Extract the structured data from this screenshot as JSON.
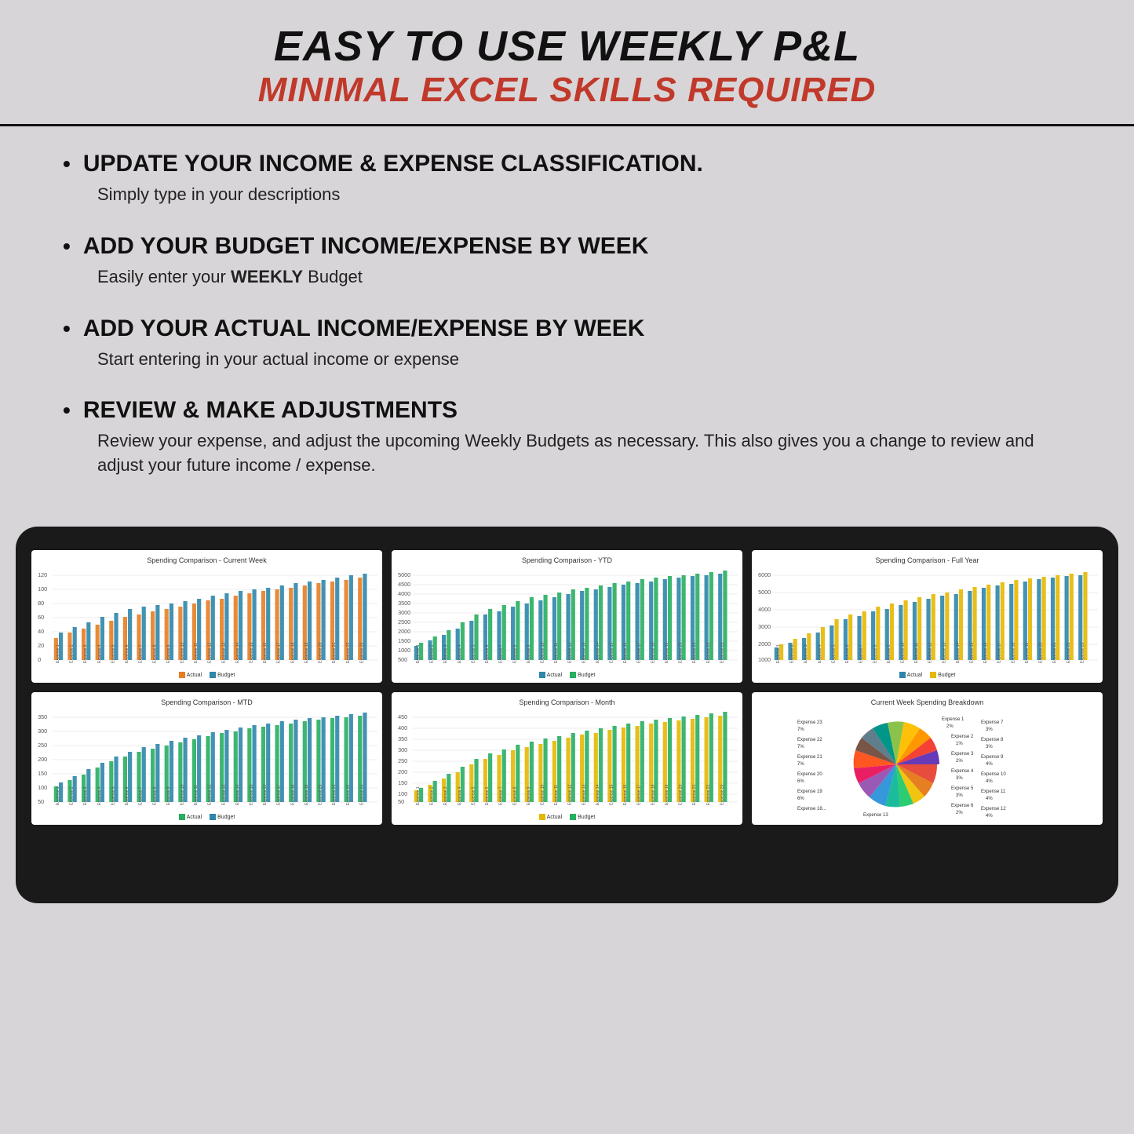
{
  "header": {
    "title_main": "EASY TO USE WEEKLY P&L",
    "title_sub": "MINIMAL EXCEL SKILLS REQUIRED"
  },
  "bullets": [
    {
      "id": "classification",
      "title": "UPDATE YOUR INCOME & EXPENSE CLASSIFICATION.",
      "body": "Simply type in your descriptions"
    },
    {
      "id": "budget",
      "title": "ADD YOUR BUDGET INCOME/EXPENSE BY WEEK",
      "body_prefix": "Easily enter your ",
      "body_bold": "WEEKLY",
      "body_suffix": " Budget"
    },
    {
      "id": "actual",
      "title": "ADD YOUR ACTUAL INCOME/EXPENSE BY WEEK",
      "body": "Start entering in your actual income or expense"
    },
    {
      "id": "review",
      "title": "REVIEW & MAKE ADJUSTMENTS",
      "body": "Review your expense, and adjust the upcoming Weekly Budgets as necessary.  This also gives you a change to review and adjust your future income / expense."
    }
  ],
  "charts": {
    "current_week": {
      "title": "Spending Comparison - Current Week",
      "y_max": 120,
      "legend": [
        "Actual",
        "Budget"
      ],
      "colors": [
        "#e67e22",
        "#2e86ab"
      ]
    },
    "ytd": {
      "title": "Spending Comparison - YTD",
      "y_max": 5000,
      "legend": [
        "Actual",
        "Budget"
      ],
      "colors": [
        "#2e86ab",
        "#27ae60"
      ]
    },
    "full_year": {
      "title": "Spending Comparison - Full Year",
      "y_max": 6000,
      "legend": [
        "Actual",
        "Budget"
      ],
      "colors": [
        "#2e86ab",
        "#e6b800"
      ]
    },
    "mtd": {
      "title": "Spending Comparison - MTD",
      "y_max": 350,
      "legend": [
        "Actual",
        "Budget"
      ],
      "colors": [
        "#27ae60",
        "#2e86ab"
      ]
    },
    "month": {
      "title": "Spending Comparison - Month",
      "y_max": 450,
      "legend": [
        "Actual",
        "Budget"
      ],
      "colors": [
        "#e6b800",
        "#27ae60"
      ]
    },
    "pie": {
      "title": "Current Week Spending Breakdown"
    }
  }
}
